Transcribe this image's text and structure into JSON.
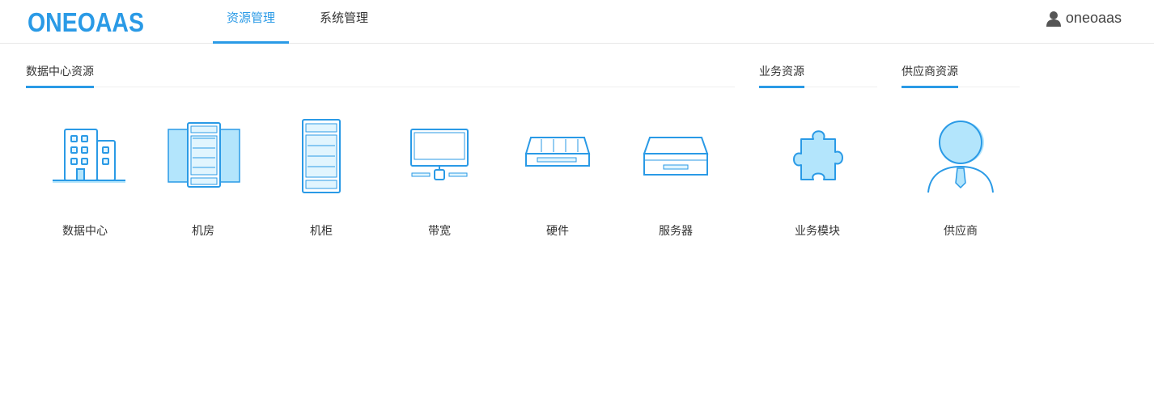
{
  "header": {
    "logo_text": "ONEOAAS",
    "tabs": [
      {
        "label": "资源管理",
        "active": true
      },
      {
        "label": "系统管理",
        "active": false
      }
    ],
    "user": "oneoaas"
  },
  "sections": [
    {
      "title": "数据中心资源",
      "items": [
        {
          "label": "数据中心",
          "icon": "building-icon"
        },
        {
          "label": "机房",
          "icon": "server-room-icon"
        },
        {
          "label": "机柜",
          "icon": "cabinet-icon"
        },
        {
          "label": "带宽",
          "icon": "monitor-icon"
        },
        {
          "label": "硬件",
          "icon": "hardware-icon"
        },
        {
          "label": "服务器",
          "icon": "server-icon"
        }
      ]
    },
    {
      "title": "业务资源",
      "items": [
        {
          "label": "业务模块",
          "icon": "puzzle-icon"
        }
      ]
    },
    {
      "title": "供应商资源",
      "items": [
        {
          "label": "供应商",
          "icon": "person-icon"
        }
      ]
    }
  ],
  "colors": {
    "accent": "#2a9ae6",
    "light": "#b3e5fc"
  }
}
